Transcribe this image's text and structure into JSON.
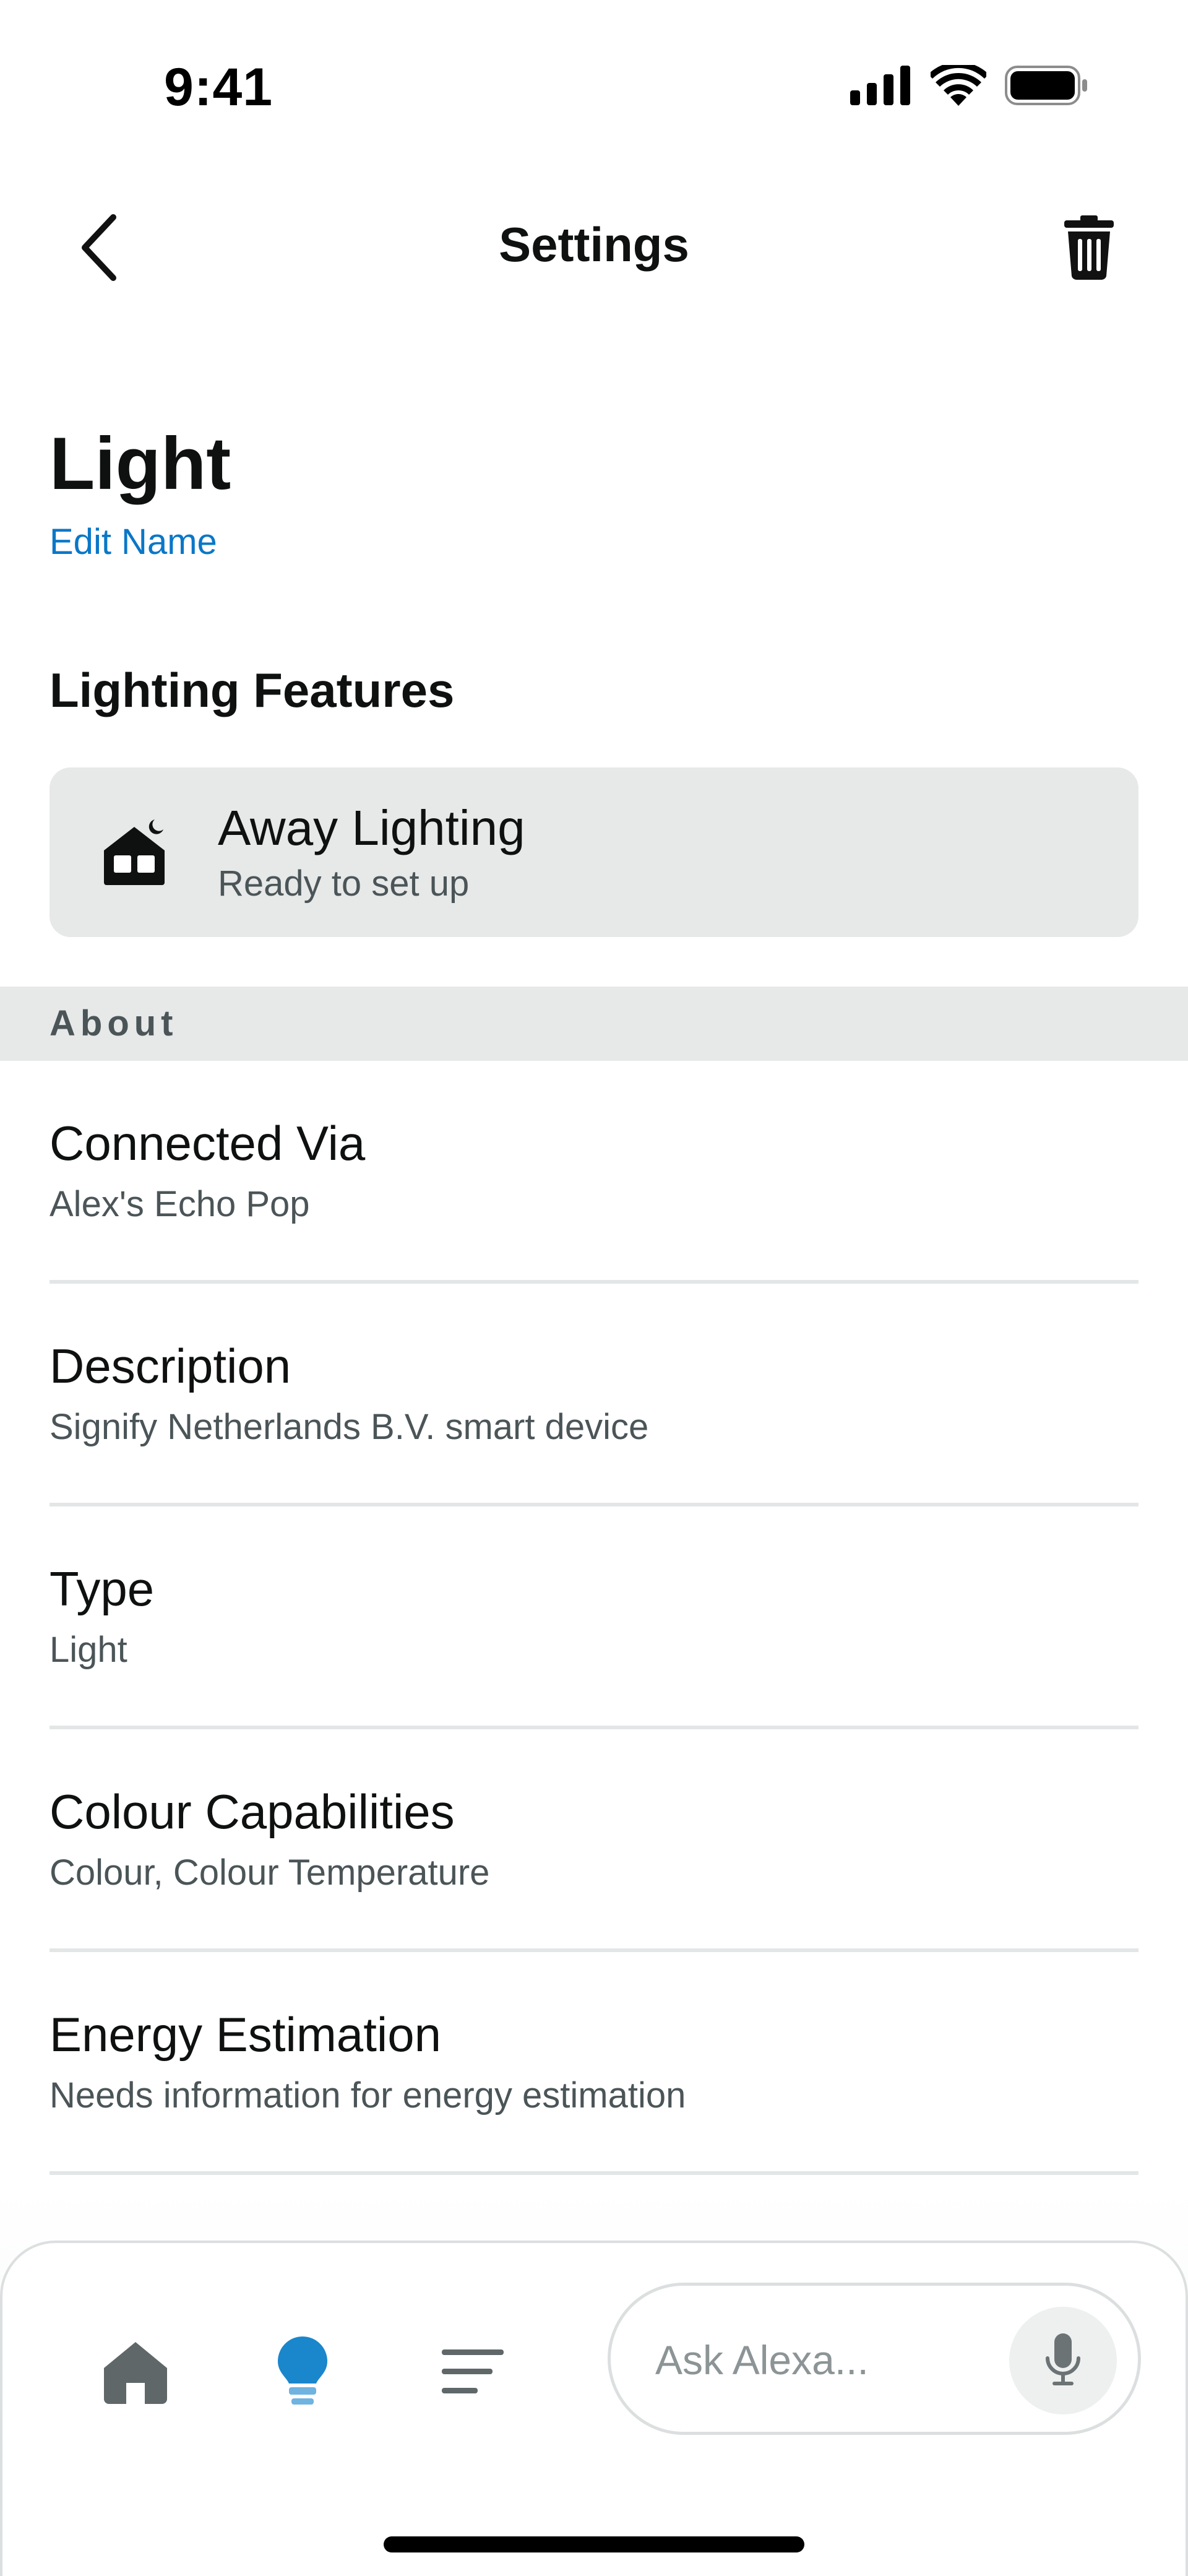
{
  "status_bar": {
    "time": "9:41"
  },
  "nav": {
    "title": "Settings"
  },
  "device": {
    "name": "Light",
    "edit_label": "Edit Name"
  },
  "lighting_features": {
    "heading": "Lighting Features",
    "items": [
      {
        "title": "Away Lighting",
        "subtitle": "Ready to set up",
        "icon": "house-moon-icon"
      }
    ]
  },
  "about": {
    "label": "About",
    "rows": [
      {
        "title": "Connected Via",
        "value": "Alex's Echo Pop"
      },
      {
        "title": "Description",
        "value": "Signify Netherlands B.V. smart device"
      },
      {
        "title": "Type",
        "value": "Light"
      },
      {
        "title": "Colour Capabilities",
        "value": "Colour, Colour Temperature"
      },
      {
        "title": "Energy Estimation",
        "value": "Needs information for energy estimation"
      }
    ]
  },
  "bottom_bar": {
    "tabs": [
      {
        "name": "home",
        "icon": "home-icon"
      },
      {
        "name": "devices",
        "icon": "lightbulb-icon",
        "active": true
      },
      {
        "name": "more",
        "icon": "menu-lines-icon"
      }
    ],
    "ask_placeholder": "Ask Alexa..."
  },
  "colors": {
    "accent": "#0a77c7",
    "active_tab": "#1a86cc",
    "section_band": "#e7e8e8",
    "text_primary": "#0f1111",
    "text_secondary": "#4b5558"
  }
}
